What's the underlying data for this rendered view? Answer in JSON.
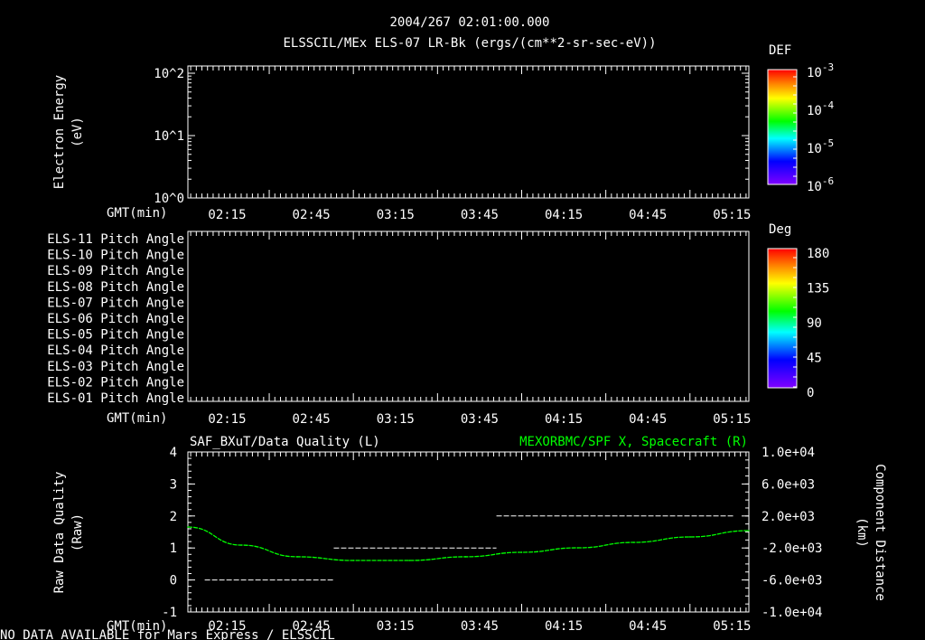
{
  "header": {
    "timestamp": "2004/267 02:01:00.000",
    "title": "ELSSCIL/MEx ELS-07 LR-Bk  (ergs/(cm**2-sr-sec-eV))"
  },
  "footer": {
    "status": "NO DATA AVAILABLE for Mars Express / ELSSCIL"
  },
  "colors": {
    "background": "#000000",
    "axes": "#ffffff",
    "quality": "#ffffff",
    "component": "#00ff00"
  },
  "chart_data": [
    {
      "type": "heatmap",
      "ylabel": "Electron Energy (eV)",
      "ylabel_lines": [
        "Electron Energy",
        "(eV)"
      ],
      "y_scale": "log",
      "y_ticks": [
        "10^2",
        "10^1",
        "10^0"
      ],
      "y_tick_values": [
        100,
        10,
        1
      ],
      "xlabel": "GMT(min)",
      "x_ticks": [
        "02:15",
        "02:45",
        "03:15",
        "03:45",
        "04:15",
        "04:45",
        "05:15"
      ],
      "x_range": [
        "02:01",
        "05:21"
      ],
      "colorbar": {
        "label": "DEF",
        "scale": "log",
        "ticks": [
          "10^-3",
          "10^-4",
          "10^-5",
          "10^-6"
        ],
        "range": [
          1e-06,
          0.001
        ]
      },
      "values": []
    },
    {
      "type": "heatmap",
      "rows": [
        "ELS-11 Pitch Angle",
        "ELS-10 Pitch Angle",
        "ELS-09 Pitch Angle",
        "ELS-08 Pitch Angle",
        "ELS-07 Pitch Angle",
        "ELS-06 Pitch Angle",
        "ELS-05 Pitch Angle",
        "ELS-04 Pitch Angle",
        "ELS-03 Pitch Angle",
        "ELS-02 Pitch Angle",
        "ELS-01 Pitch Angle"
      ],
      "xlabel": "GMT(min)",
      "x_ticks": [
        "02:15",
        "02:45",
        "03:15",
        "03:45",
        "04:15",
        "04:45",
        "05:15"
      ],
      "colorbar": {
        "label": "Deg",
        "ticks": [
          "180",
          "135",
          "90",
          "45",
          "0"
        ],
        "range": [
          0,
          180
        ]
      },
      "values": []
    },
    {
      "type": "line",
      "title_left": "SAF_BXuT/Data Quality (L)",
      "title_right": "MEXORBMC/SPF X, Spacecraft (R)",
      "ylabel_left_lines": [
        "Raw Data Quality",
        "(Raw)"
      ],
      "ylabel_right_lines": [
        "Component Distance",
        "(km)"
      ],
      "xlabel": "GMT(min)",
      "x_ticks": [
        "02:15",
        "02:45",
        "03:15",
        "03:45",
        "04:15",
        "04:45",
        "05:15"
      ],
      "x_range": [
        "02:01",
        "05:21"
      ],
      "ylim_left": [
        -1,
        4
      ],
      "y_ticks_left": [
        "4",
        "3",
        "2",
        "1",
        "0",
        "-1"
      ],
      "ylim_right": [
        -10000,
        10000
      ],
      "y_ticks_right": [
        "1.0e+04",
        "6.0e+03",
        "2.0e+03",
        "-2.0e+03",
        "-6.0e+03",
        "-1.0e+04"
      ],
      "series": [
        {
          "axis": "left",
          "style": "segments",
          "segments": [
            {
              "start": "02:07",
              "end": "02:53",
              "value": 0
            },
            {
              "start": "02:53",
              "end": "03:51",
              "value": 1
            },
            {
              "start": "03:51",
              "end": "05:16",
              "value": 2
            }
          ]
        },
        {
          "axis": "right",
          "x": [
            "02:01",
            "02:20",
            "02:40",
            "03:00",
            "03:20",
            "03:40",
            "04:00",
            "04:20",
            "04:40",
            "05:00",
            "05:21"
          ],
          "values": [
            620,
            -1640,
            -3100,
            -3560,
            -3560,
            -3100,
            -2540,
            -1980,
            -1300,
            -620,
            170
          ]
        }
      ]
    }
  ]
}
